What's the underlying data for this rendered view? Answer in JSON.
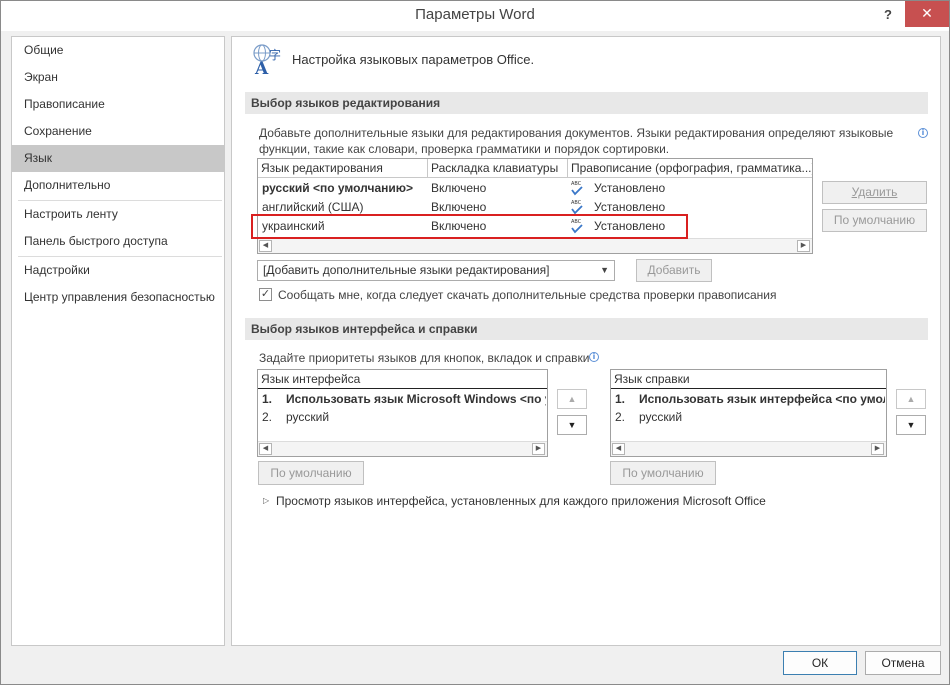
{
  "window": {
    "title": "Параметры Word",
    "help": "?",
    "close": "✕"
  },
  "sidebar": {
    "items": [
      {
        "label": "Общие"
      },
      {
        "label": "Экран"
      },
      {
        "label": "Правописание"
      },
      {
        "label": "Сохранение"
      },
      {
        "label": "Язык"
      },
      {
        "label": "Дополнительно"
      },
      {
        "label": "Настроить ленту"
      },
      {
        "label": "Панель быстрого доступа"
      },
      {
        "label": "Надстройки"
      },
      {
        "label": "Центр управления безопасностью"
      }
    ],
    "active": "Язык"
  },
  "header": {
    "title": "Настройка языковых параметров Office."
  },
  "editing": {
    "section_title": "Выбор языков редактирования",
    "description_line1": "Добавьте дополнительные языки для редактирования документов. Языки редактирования определяют языковые",
    "description_line2": "функции, такие как словари, проверка грамматики и порядок сортировки.",
    "columns": [
      "Язык редактирования",
      "Раскладка клавиатуры",
      "Правописание (орфография, грамматика...)"
    ],
    "rows": [
      {
        "language": "русский <по умолчанию>",
        "keyboard": "Включено",
        "proofing": "Установлено",
        "bold": true
      },
      {
        "language": "английский (США)",
        "keyboard": "Включено",
        "proofing": "Установлено",
        "bold": false
      },
      {
        "language": "украинский",
        "keyboard": "Включено",
        "proofing": "Установлено",
        "bold": false
      }
    ],
    "remove_label": "Удалить",
    "default_label": "По умолчанию",
    "add_dropdown": "[Добавить дополнительные языки редактирования]",
    "add_label": "Добавить",
    "notify_label": "Сообщать мне, когда следует скачать дополнительные средства проверки правописания",
    "notify_checked": true
  },
  "ui_lang": {
    "section_title": "Выбор языков интерфейса и справки",
    "description": "Задайте приоритеты языков для кнопок, вкладок и справки",
    "display": {
      "header": "Язык интерфейса",
      "items": [
        {
          "num": "1.",
          "text": "Использовать язык Microsoft Windows <по у"
        },
        {
          "num": "2.",
          "text": "русский"
        }
      ],
      "default_label": "По умолчанию"
    },
    "help": {
      "header": "Язык справки",
      "items": [
        {
          "num": "1.",
          "text": "Использовать язык интерфейса <по умолча"
        },
        {
          "num": "2.",
          "text": "русский"
        }
      ],
      "default_label": "По умолчанию"
    },
    "view_link": "Просмотр языков интерфейса, установленных для каждого приложения Microsoft Office"
  },
  "footer": {
    "ok": "ОК",
    "cancel": "Отмена"
  },
  "colors": {
    "highlight": "#d92020",
    "close": "#c75050",
    "active_nav": "#c8c8c8"
  }
}
